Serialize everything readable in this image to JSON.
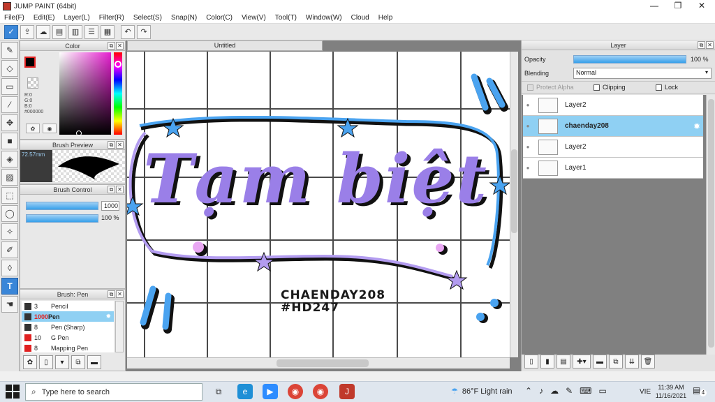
{
  "window": {
    "title": "JUMP PAINT (64bit)",
    "minimize": "—",
    "restore": "❐",
    "close": "✕"
  },
  "menu": [
    "File(F)",
    "Edit(E)",
    "Layer(L)",
    "Filter(R)",
    "Select(S)",
    "Snap(N)",
    "Color(C)",
    "View(V)",
    "Tool(T)",
    "Window(W)",
    "Cloud",
    "Help"
  ],
  "toolbar": {
    "undo": "↶",
    "redo": "↷"
  },
  "color_panel": {
    "title": "Color",
    "r": "R:0",
    "g": "G:0",
    "b": "B:0",
    "hex": "#000000"
  },
  "brush_preview": {
    "title": "Brush Preview",
    "size": "72.57mm"
  },
  "brush_control": {
    "title": "Brush Control",
    "size_value": "1000",
    "opacity_value": "100 %"
  },
  "brush_list": {
    "title": "Brush: Pen",
    "items": [
      {
        "size": "3",
        "name": "Pencil",
        "color": "#333333"
      },
      {
        "size": "1000",
        "name": "Pen",
        "color": "#333333"
      },
      {
        "size": "8",
        "name": "Pen (Sharp)",
        "color": "#333333"
      },
      {
        "size": "10",
        "name": "G Pen",
        "color": "#e02020"
      },
      {
        "size": "8",
        "name": "Mapping Pen",
        "color": "#e02020"
      }
    ]
  },
  "document": {
    "tab_title": "Untitled",
    "art_title": "Tạm biệt",
    "art_line1": "CHAENDAY208",
    "art_line2": "#HD247"
  },
  "layer_panel": {
    "title": "Layer",
    "opacity_label": "Opacity",
    "opacity_value": "100 %",
    "blending_label": "Blending",
    "blending_value": "Normal",
    "protect_alpha": "Protect Alpha",
    "clipping": "Clipping",
    "lock": "Lock",
    "layers": [
      {
        "name": "Layer2",
        "selected": false
      },
      {
        "name": "chaenday208",
        "selected": true
      },
      {
        "name": "Layer2",
        "selected": false
      },
      {
        "name": "Layer1",
        "selected": false
      }
    ]
  },
  "taskbar": {
    "search_placeholder": "Type here to search",
    "weather": "86°F  Light rain",
    "language": "VIE",
    "time": "11:39 AM",
    "date": "11/16/2021",
    "notifications": "4"
  },
  "colors": {
    "accent": "#3a86d8",
    "selected_layer": "#8fd0f3",
    "art_blue": "#4aa3f0",
    "art_pink": "#e9a7f3"
  }
}
